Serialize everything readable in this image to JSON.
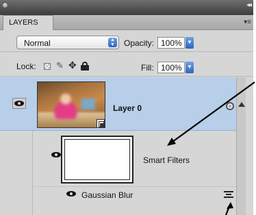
{
  "panel": {
    "tab_label": "LAYERS"
  },
  "blending": {
    "mode": "Normal",
    "opacity_label": "Opacity:",
    "opacity_value": "100%"
  },
  "lock": {
    "label": "Lock:",
    "fill_label": "Fill:",
    "fill_value": "100%"
  },
  "layers": [
    {
      "name": "Layer 0",
      "visible": true,
      "selected": true,
      "smart_filters": {
        "label": "Smart Filters",
        "visible": true,
        "filters": [
          {
            "name": "Gaussian Blur",
            "visible": true
          }
        ]
      }
    }
  ],
  "icons": [
    "close-icon",
    "panel-menu-icon",
    "eye-icon",
    "lock-transparent-icon",
    "lock-paint-icon",
    "lock-move-icon",
    "lock-all-icon",
    "smart-object-icon",
    "filter-options-icon"
  ],
  "colors": {
    "selected_row": "#b8cfe9",
    "panel_bg": "#d6d6d6",
    "dropdown_accent": "#3b74d1"
  }
}
